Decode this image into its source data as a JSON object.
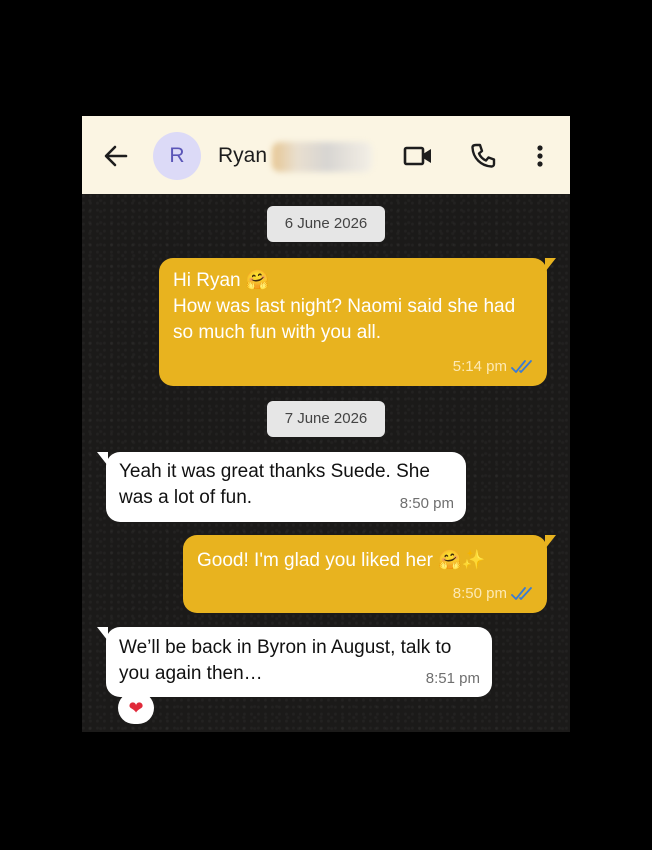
{
  "header": {
    "avatar_letter": "R",
    "contact_name": "Ryan"
  },
  "colors": {
    "header_bg": "#fbf5e3",
    "outgoing_bubble": "#e8b31f",
    "incoming_bubble": "#ffffff",
    "read_ticks": "#3a7bd5",
    "chat_bg": "#1b1a19"
  },
  "icons": {
    "back": "arrow-left-icon",
    "video": "video-call-icon",
    "phone": "phone-icon",
    "menu": "more-vertical-icon",
    "ticks": "double-check-icon",
    "reaction": "red-heart"
  },
  "messages": [
    {
      "type": "date",
      "label": "6 June 2026"
    },
    {
      "type": "out",
      "text": "Hi Ryan 🤗\nHow was last night? Naomi said she had so much fun with you all.",
      "time": "5:14 pm"
    },
    {
      "type": "date",
      "label": "7 June 2026"
    },
    {
      "type": "in",
      "text": "Yeah it was great thanks Suede. She was a lot of fun.",
      "time": "8:50 pm"
    },
    {
      "type": "out",
      "text": "Good! I'm glad you liked her 🤗✨",
      "time": "8:50 pm"
    },
    {
      "type": "in",
      "text": "We’ll be back in Byron in August, talk to you again then…",
      "time": "8:51 pm",
      "reaction": "❤"
    }
  ]
}
